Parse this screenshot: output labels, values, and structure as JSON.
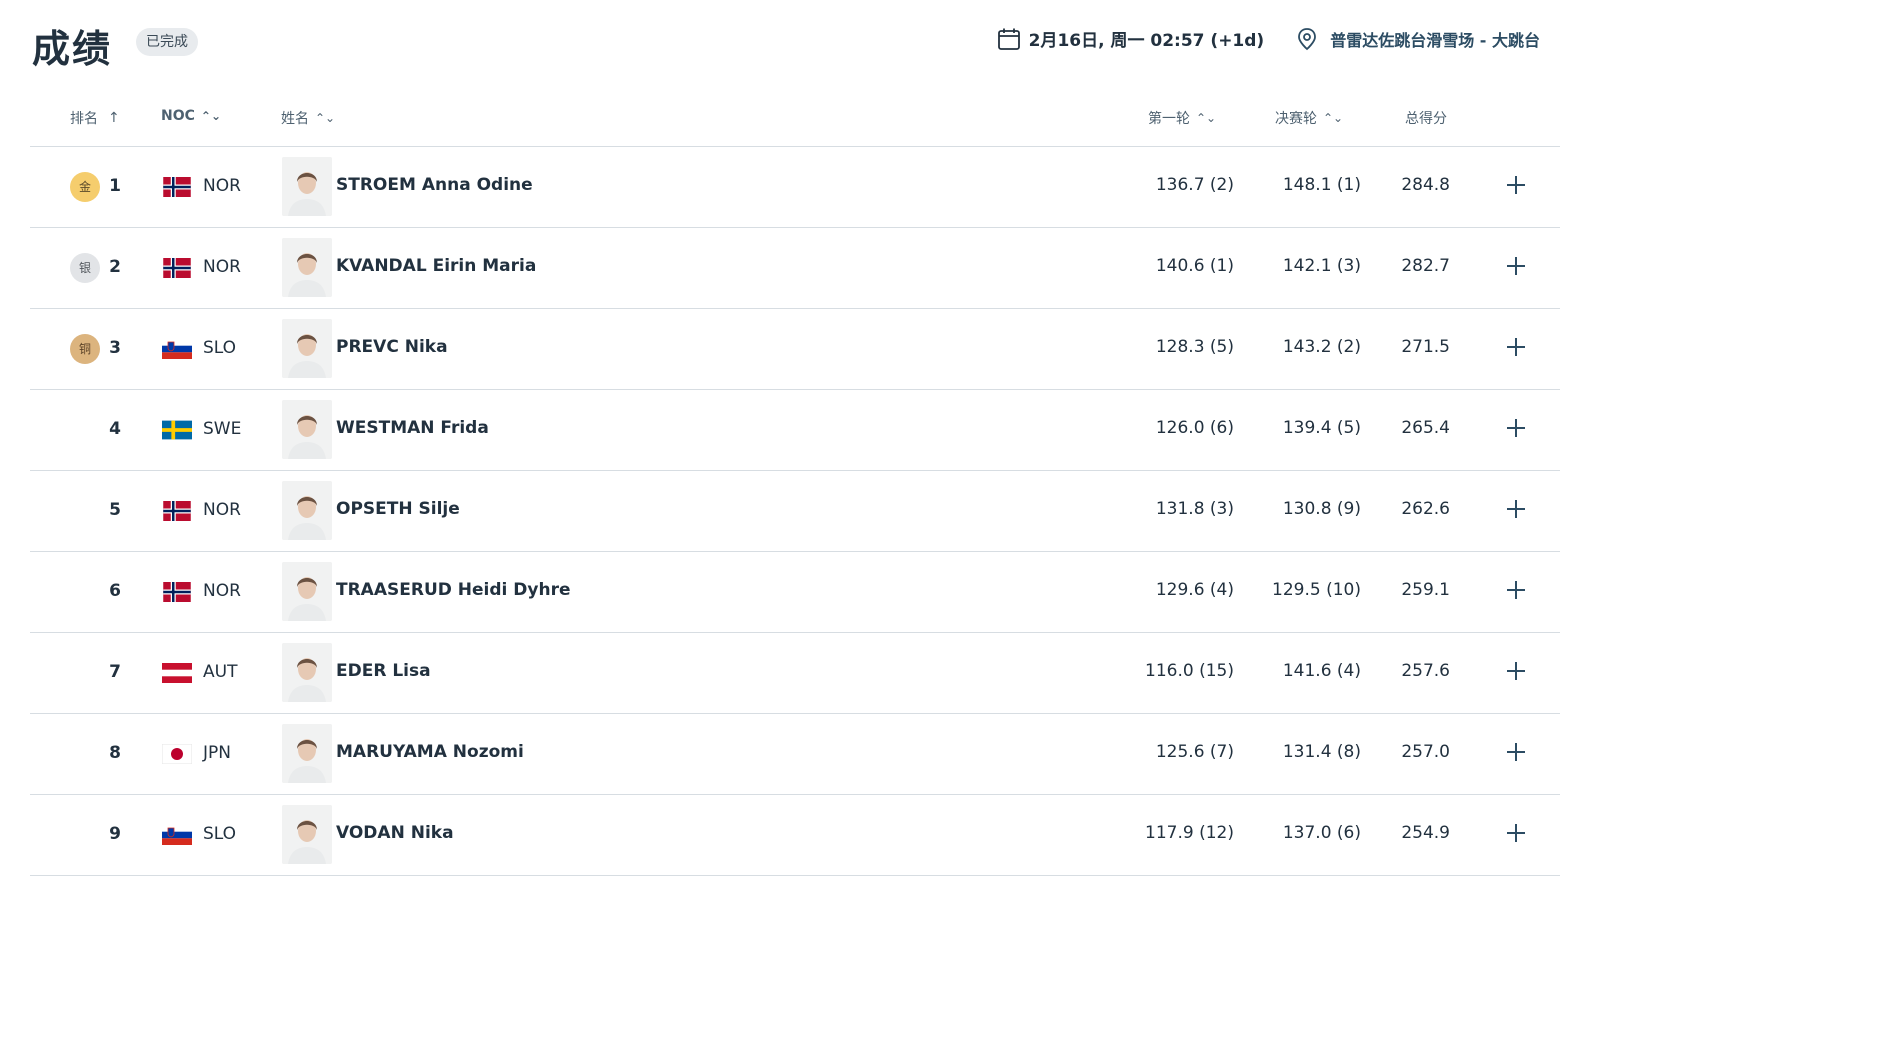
{
  "header": {
    "title": "成绩",
    "status": "已完成",
    "datetime": "2月16日, 周一 02:57 (+1d)",
    "venue": "普雷达佐跳台滑雪场 - 大跳台"
  },
  "columns": {
    "rank": "排名",
    "noc": "NOC",
    "name": "姓名",
    "round1": "第一轮",
    "final": "决赛轮",
    "total": "总得分"
  },
  "rows": [
    {
      "rank": "1",
      "medal": "金",
      "medal_type": "gold",
      "noc": "NOR",
      "name": "STROEM Anna Odine",
      "round1": "136.7 (2)",
      "final": "148.1 (1)",
      "total": "284.8"
    },
    {
      "rank": "2",
      "medal": "银",
      "medal_type": "silver",
      "noc": "NOR",
      "name": "KVANDAL Eirin Maria",
      "round1": "140.6 (1)",
      "final": "142.1 (3)",
      "total": "282.7"
    },
    {
      "rank": "3",
      "medal": "铜",
      "medal_type": "bronze",
      "noc": "SLO",
      "name": "PREVC Nika",
      "round1": "128.3 (5)",
      "final": "143.2 (2)",
      "total": "271.5"
    },
    {
      "rank": "4",
      "medal": "",
      "medal_type": "",
      "noc": "SWE",
      "name": "WESTMAN Frida",
      "round1": "126.0 (6)",
      "final": "139.4 (5)",
      "total": "265.4"
    },
    {
      "rank": "5",
      "medal": "",
      "medal_type": "",
      "noc": "NOR",
      "name": "OPSETH Silje",
      "round1": "131.8 (3)",
      "final": "130.8 (9)",
      "total": "262.6"
    },
    {
      "rank": "6",
      "medal": "",
      "medal_type": "",
      "noc": "NOR",
      "name": "TRAASERUD Heidi Dyhre",
      "round1": "129.6 (4)",
      "final": "129.5 (10)",
      "total": "259.1"
    },
    {
      "rank": "7",
      "medal": "",
      "medal_type": "",
      "noc": "AUT",
      "name": "EDER Lisa",
      "round1": "116.0 (15)",
      "final": "141.6 (4)",
      "total": "257.6"
    },
    {
      "rank": "8",
      "medal": "",
      "medal_type": "",
      "noc": "JPN",
      "name": "MARUYAMA Nozomi",
      "round1": "125.6 (7)",
      "final": "131.4 (8)",
      "total": "257.0"
    },
    {
      "rank": "9",
      "medal": "",
      "medal_type": "",
      "noc": "SLO",
      "name": "VODAN Nika",
      "round1": "117.9 (12)",
      "final": "137.0 (6)",
      "total": "254.9"
    }
  ],
  "colors": {
    "text": "#22313f",
    "accent": "#2c4c63",
    "gold": "#f5cd6d",
    "silver": "#e2e4e7",
    "bronze": "#dcb47e"
  }
}
